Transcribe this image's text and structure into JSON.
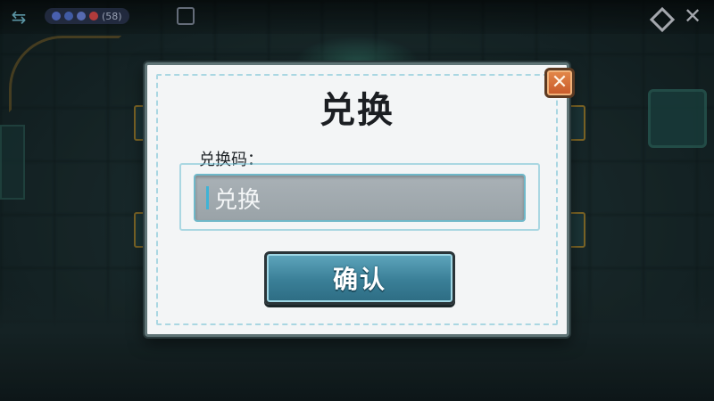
{
  "hud": {
    "back_icon": "back-arrows-icon",
    "status_text": "(58)",
    "settings_icon": "diamond-icon",
    "close_icon": "close-x-icon"
  },
  "dialog": {
    "title": "兑换",
    "close_icon": "close-x-icon",
    "code_label": "兑换码：",
    "code_input": {
      "value": "",
      "placeholder": "兑换"
    },
    "confirm_label": "确认"
  },
  "colors": {
    "dialog_bg": "#f3f5f6",
    "close_button": "#d8703a",
    "confirm_button": "#3a7f97",
    "input_bg": "#a3abb0",
    "accent_cyan": "#6fb8c9"
  }
}
